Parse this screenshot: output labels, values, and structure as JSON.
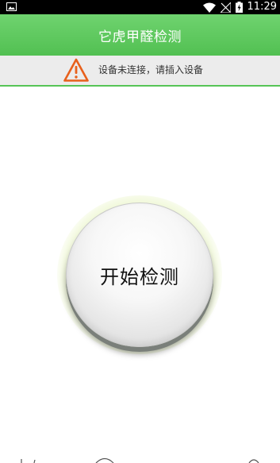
{
  "status_bar": {
    "time": "11:29",
    "icons": [
      "image-icon",
      "wifi-icon",
      "signal-off-icon",
      "battery-charging-icon"
    ]
  },
  "app_bar": {
    "title": "它虎甲醛检测"
  },
  "alert": {
    "icon": "warning-icon",
    "text": "设备未连接，请插入设备"
  },
  "main": {
    "start_button_label": "开始检测"
  },
  "colors": {
    "header_green": "#5ac85a",
    "alert_bg": "#ececec",
    "warning_orange": "#e8601c"
  }
}
